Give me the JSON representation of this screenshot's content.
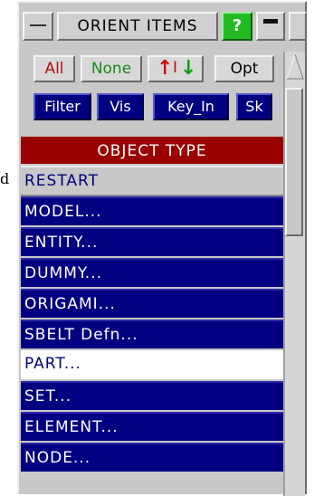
{
  "stray_text": "d",
  "title_bar": {
    "title": "ORIENT ITEMS",
    "help_label": "?"
  },
  "buttons": {
    "all": "All",
    "none": "None",
    "sort_up": "↑",
    "sort_sep": "I",
    "sort_down": "↓",
    "opt": "Opt",
    "filter": "Filter",
    "vis": "Vis",
    "key_in": "Key_In",
    "sk": "Sk"
  },
  "list": {
    "header": "OBJECT TYPE",
    "items": [
      {
        "label": "RESTART",
        "state": "grey"
      },
      {
        "label": "MODEL...",
        "state": "blue"
      },
      {
        "label": "ENTITY...",
        "state": "blue"
      },
      {
        "label": "DUMMY...",
        "state": "blue"
      },
      {
        "label": "ORIGAMI...",
        "state": "blue"
      },
      {
        "label": "SBELT Defn...",
        "state": "blue"
      },
      {
        "label": "PART...",
        "state": "white"
      },
      {
        "label": "SET...",
        "state": "blue"
      },
      {
        "label": "ELEMENT...",
        "state": "blue"
      },
      {
        "label": "NODE...",
        "state": "blue"
      }
    ]
  },
  "colors": {
    "list_blue": "#000080",
    "header_red": "#9a0000",
    "help_green": "#22bb22",
    "panel_grey": "#c8c8c8"
  }
}
